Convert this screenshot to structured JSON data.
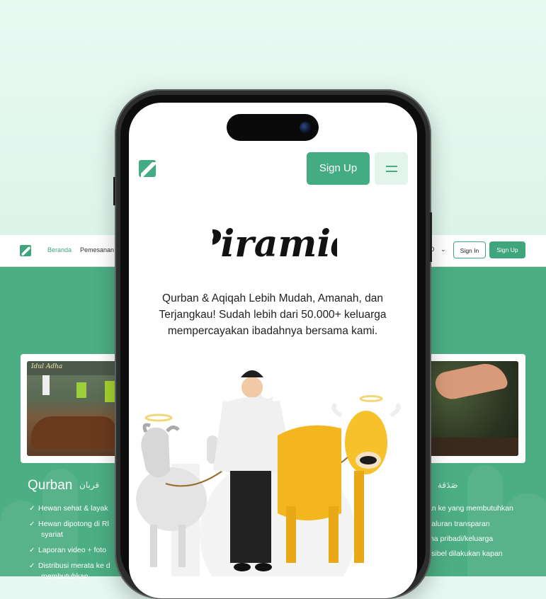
{
  "desktop": {
    "nav": {
      "links": [
        "Beranda",
        "Pemesanan"
      ],
      "lang_suffix": "D",
      "sign_in": "Sign In",
      "sign_up": "Sign Up"
    },
    "sections": [
      {
        "title": "Qurban",
        "arabic": "قربان",
        "features": [
          "Hewan sehat & layak",
          "Hewan dipotong di Rl",
          "syariat",
          "Laporan video + foto",
          "Distribusi merata ke d",
          "membutuhkan"
        ]
      },
      {
        "arabic": "صَدَقة",
        "features": [
          "an ke yang membutuhkan",
          "yaluran transparan",
          "ma pribadi/keluarga",
          "ksibel dilakukan kapan"
        ]
      }
    ]
  },
  "mobile": {
    "sign_up": "Sign Up",
    "brand": "Piramid",
    "tagline": "Qurban & Aqiqah Lebih Mudah, Amanah, dan Terjangkau! Sudah lebih dari 50.000+ keluarga mempercayakan ibadahnya bersama kami."
  },
  "colors": {
    "brand_green": "#44ac82",
    "section_green": "#4cae83",
    "menu_bg": "#e3f4ec"
  },
  "icons": [
    "logo-icon",
    "menu-icon",
    "chevron-down-icon",
    "check-icon"
  ]
}
